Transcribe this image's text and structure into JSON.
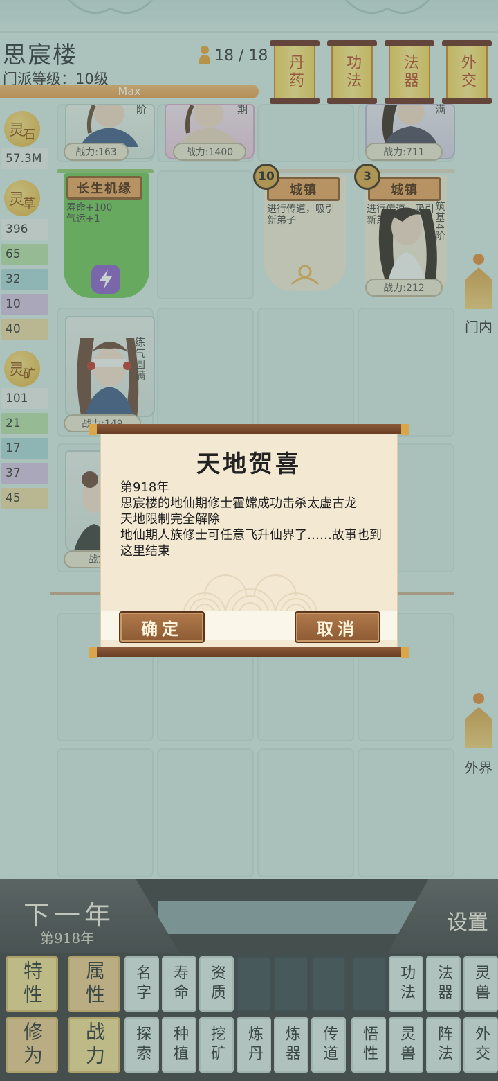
{
  "header": {
    "sect_name": "思宸楼",
    "sect_level": "门派等级：10级",
    "disciple_count": "18 / 18",
    "level_bar_text": "Max",
    "level_progress": 1.0
  },
  "top_menu": [
    {
      "label": "丹药",
      "name": "scroll-button-pills"
    },
    {
      "label": "功法",
      "name": "scroll-button-techniques"
    },
    {
      "label": "法器",
      "name": "scroll-button-artifacts"
    },
    {
      "label": "外交",
      "name": "scroll-button-diplomacy"
    }
  ],
  "resources": {
    "spirit_stone": {
      "badge": "灵",
      "sub": "石",
      "value": "57.3M"
    },
    "spirit_herb": {
      "badge": "灵",
      "sub": "草",
      "values": [
        "396",
        "65",
        "32",
        "10",
        "40"
      ]
    },
    "spirit_ore": {
      "badge": "灵",
      "sub": "矿",
      "values": [
        "101",
        "21",
        "17",
        "37",
        "45"
      ]
    }
  },
  "tier_colors": [
    "#e9ebea",
    "#b5dca6",
    "#a9d4d6",
    "#d2c0e0",
    "#ead8a3"
  ],
  "cards": {
    "disciple_1_power": "战力:163",
    "disciple_2_power": "战力:1400",
    "disciple_2_stage": "期",
    "disciple_3_power": "战力:711",
    "disciple_3_stage": "满",
    "disciple_1_stage": "阶",
    "longevity": {
      "title": "长生机缘",
      "line1": "寿命+100",
      "line2": "气运+1"
    },
    "town_1": {
      "badge": "10",
      "title": "城镇",
      "desc": "进行传道，吸引新弟子"
    },
    "town_2": {
      "badge": "3",
      "title": "城镇",
      "desc": "进行传道，吸引新弟子",
      "power": "战力:212",
      "stage": "筑基4阶"
    },
    "disciple_4_power": "战力:149",
    "disciple_4_stage": "练气圆满",
    "disciple_5_power": "战力:1"
  },
  "side_tabs": {
    "inner": "门内",
    "outer": "外界"
  },
  "bottom": {
    "next_year": "下一年",
    "year_label": "第918年",
    "settings": "设置"
  },
  "sort_buttons_row1": [
    "特性",
    "属性",
    "名字",
    "寿命",
    "资质",
    "",
    "",
    "",
    "",
    "功法",
    "法器",
    "灵兽"
  ],
  "sort_buttons_row2": [
    "修为",
    "战力",
    "探索",
    "种植",
    "挖矿",
    "炼丹",
    "炼器",
    "传道",
    "悟性",
    "灵兽",
    "阵法",
    "外交"
  ],
  "modal": {
    "title": "天地贺喜",
    "line1": "第918年",
    "line2": "思宸楼的地仙期修士霍嫦成功击杀太虚古龙",
    "line3": "天地限制完全解除",
    "line4": "地仙期人族修士可任意飞升仙界了……故事也到这里结束",
    "confirm": "确定",
    "cancel": "取消"
  }
}
